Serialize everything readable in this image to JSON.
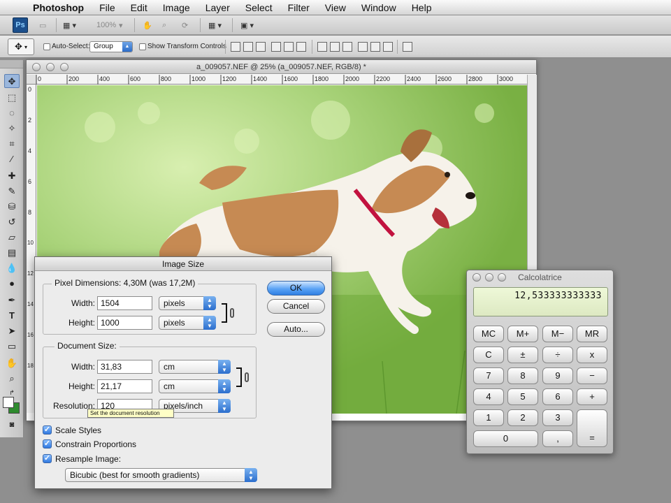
{
  "menubar": {
    "app_name": "Photoshop",
    "items": [
      "File",
      "Edit",
      "Image",
      "Layer",
      "Select",
      "Filter",
      "View",
      "Window",
      "Help"
    ]
  },
  "appbar": {
    "logo": "Ps",
    "zoom": "100%"
  },
  "options_bar": {
    "auto_select_label": "Auto-Select:",
    "auto_select_value": "Group",
    "transform_label": "Show Transform Controls"
  },
  "document": {
    "title": "a_009057.NEF @ 25% (a_009057.NEF, RGB/8) *",
    "ruler_h": [
      "0",
      "200",
      "400",
      "600",
      "800",
      "1000",
      "1200",
      "1400",
      "1600",
      "1800",
      "2000",
      "2200",
      "2400",
      "2600",
      "2800",
      "3000"
    ],
    "ruler_v": [
      "0",
      "2",
      "4",
      "6",
      "8",
      "10",
      "12",
      "14",
      "16",
      "18"
    ]
  },
  "image_size_dialog": {
    "title": "Image Size",
    "pixel_dimensions_label": "Pixel Dimensions:",
    "pixel_dimensions_value": "4,30M (was 17,2M)",
    "width_label": "Width:",
    "height_label": "Height:",
    "pixel_width": "1504",
    "pixel_height": "1000",
    "pixel_unit_w": "pixels",
    "pixel_unit_h": "pixels",
    "document_size_label": "Document Size:",
    "doc_width": "31,83",
    "doc_height": "21,17",
    "doc_unit_w": "cm",
    "doc_unit_h": "cm",
    "resolution_label": "Resolution:",
    "resolution": "120",
    "resolution_unit": "pixels/inch",
    "tooltip": "Set the document resolution",
    "ok": "OK",
    "cancel": "Cancel",
    "auto": "Auto...",
    "scale_styles": "Scale Styles",
    "constrain_proportions": "Constrain Proportions",
    "resample_image": "Resample Image:",
    "resample_method": "Bicubic (best for smooth gradients)"
  },
  "calculator": {
    "title": "Calcolatrice",
    "display": "12,533333333333",
    "keys": {
      "mc": "MC",
      "mplus": "M+",
      "mminus": "M−",
      "mr": "MR",
      "c": "C",
      "pm": "±",
      "div": "÷",
      "mul": "x",
      "k7": "7",
      "k8": "8",
      "k9": "9",
      "minus": "−",
      "k4": "4",
      "k5": "5",
      "k6": "6",
      "plus": "+",
      "k1": "1",
      "k2": "2",
      "k3": "3",
      "k0": "0",
      "comma": ",",
      "eq": "="
    }
  },
  "colors": {
    "accent": "#2f7fe3",
    "lcd": "#e6f1cd",
    "foreground_swatch": "#ffffff",
    "background_swatch": "#2e8b2e"
  }
}
